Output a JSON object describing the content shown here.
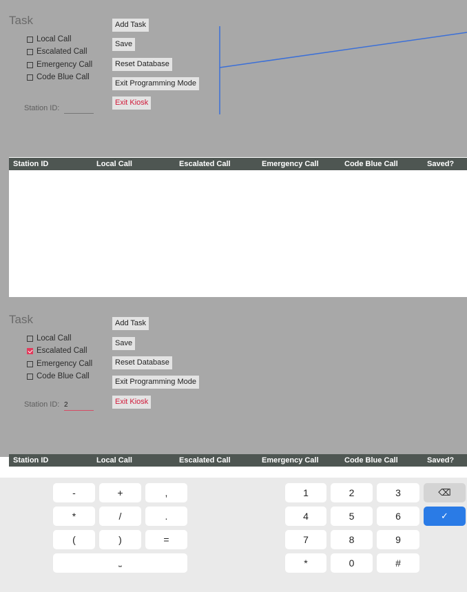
{
  "screen1": {
    "title": "Task",
    "checkboxes": [
      {
        "label": "Local Call",
        "checked": false
      },
      {
        "label": "Escalated Call",
        "checked": false
      },
      {
        "label": "Emergency Call",
        "checked": false
      },
      {
        "label": "Code Blue Call",
        "checked": false
      }
    ],
    "station_label": "Station ID:",
    "station_value": "",
    "buttons": {
      "add_task": "Add Task",
      "save": "Save",
      "reset_db": "Reset Database",
      "exit_prog": "Exit Programming Mode",
      "exit_kiosk": "Exit Kiosk"
    },
    "table_headers": [
      "Station ID",
      "Local Call",
      "Escalated Call",
      "Emergency Call",
      "Code Blue Call",
      "Saved?"
    ]
  },
  "screen2": {
    "title": "Task",
    "checkboxes": [
      {
        "label": "Local Call",
        "checked": false
      },
      {
        "label": "Escalated Call",
        "checked": true
      },
      {
        "label": "Emergency Call",
        "checked": false
      },
      {
        "label": "Code Blue Call",
        "checked": false
      }
    ],
    "station_label": "Station ID:",
    "station_value": "2",
    "buttons": {
      "add_task": "Add Task",
      "save": "Save",
      "reset_db": "Reset Database",
      "exit_prog": "Exit Programming Mode",
      "exit_kiosk": "Exit Kiosk"
    },
    "table_headers": [
      "Station ID",
      "Local Call",
      "Escalated Call",
      "Emergency Call",
      "Code Blue Call",
      "Saved?"
    ]
  },
  "keyboard": {
    "symbols": [
      "-",
      "+",
      ",",
      "*",
      "/",
      ".",
      "(",
      ")",
      "="
    ],
    "space": "⎵",
    "digits": [
      "1",
      "2",
      "3",
      "4",
      "5",
      "6",
      "7",
      "8",
      "9",
      "*",
      "0",
      "#"
    ],
    "backspace_icon": "⌫",
    "enter_icon": "✓"
  },
  "colors": {
    "panel_bg": "#a8a8a8",
    "table_header_bg": "#4e5652",
    "accent_red": "#d11a3a",
    "checkbox_checked": "#e23b5c",
    "blue_line": "#3a6fd8",
    "enter_key": "#2a7be6"
  }
}
